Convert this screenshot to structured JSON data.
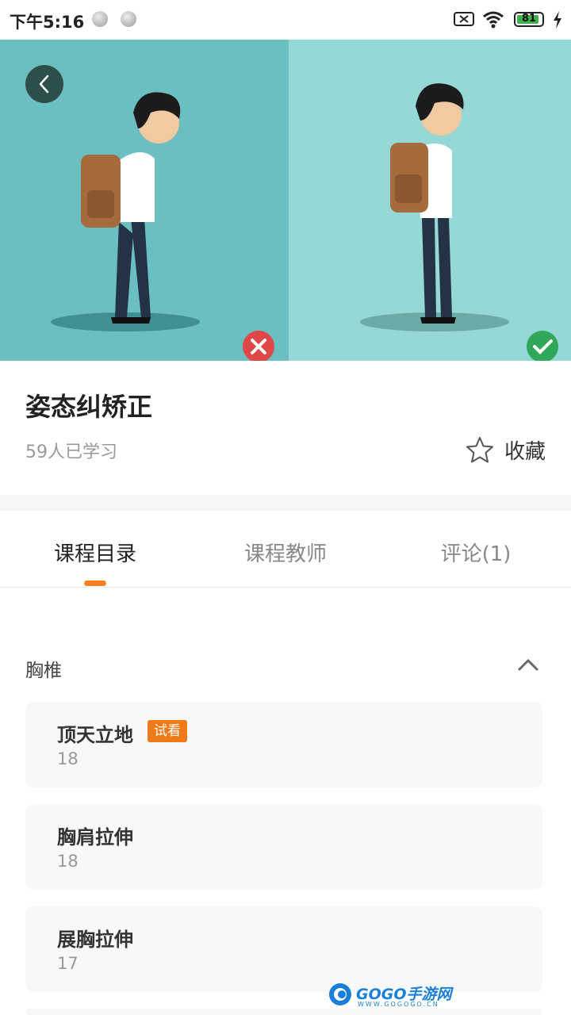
{
  "status_bar": {
    "time": "下午5:16",
    "battery": "81"
  },
  "course": {
    "title": "姿态纠矫正",
    "learners": "59人已学习",
    "favorite_label": "收藏"
  },
  "tabs": [
    {
      "label": "课程目录",
      "active": true
    },
    {
      "label": "课程教师",
      "active": false
    },
    {
      "label": "评论(1)",
      "active": false
    }
  ],
  "section": {
    "title": "胸椎",
    "lessons": [
      {
        "title": "顶天立地",
        "count": "18",
        "badge": "试看"
      },
      {
        "title": "胸肩拉伸",
        "count": "18"
      },
      {
        "title": "展胸拉伸",
        "count": "17"
      }
    ]
  },
  "watermark": {
    "brand": "GOGO手游网",
    "url": "WWW.GOGOGO.CN"
  },
  "colors": {
    "accent": "#f5821f",
    "badge": "#ef7a1a",
    "hero_left": "#6bbfc1",
    "hero_right": "#95d8d5",
    "wrong": "#e04848",
    "right": "#2fa85a"
  }
}
